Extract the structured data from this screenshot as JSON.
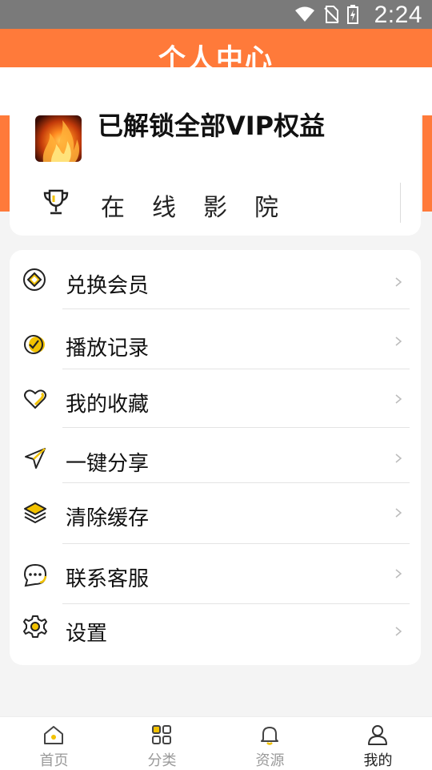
{
  "status_bar": {
    "time": "2:24"
  },
  "header": {
    "title": "个人中心"
  },
  "profile": {
    "vip_status": "已解锁全部VIP权益",
    "cinema_label": "在线影院"
  },
  "menu": {
    "items": [
      {
        "label": "兑换会员",
        "icon": "exchange-diamond-icon"
      },
      {
        "label": "播放记录",
        "icon": "check-circle-icon"
      },
      {
        "label": "我的收藏",
        "icon": "heart-icon"
      },
      {
        "label": "一键分享",
        "icon": "send-arrow-icon"
      },
      {
        "label": "清除缓存",
        "icon": "layers-icon"
      },
      {
        "label": "联系客服",
        "icon": "chat-bubble-icon"
      },
      {
        "label": "设置",
        "icon": "gear-icon"
      }
    ]
  },
  "bottom_nav": {
    "items": [
      {
        "label": "首页",
        "icon": "home-icon"
      },
      {
        "label": "分类",
        "icon": "grid-icon"
      },
      {
        "label": "资源",
        "icon": "bell-icon"
      },
      {
        "label": "我的",
        "icon": "user-icon"
      }
    ],
    "active_index": 3
  },
  "colors": {
    "brand_orange": "#ff7a3a",
    "accent_yellow": "#f2c200"
  }
}
